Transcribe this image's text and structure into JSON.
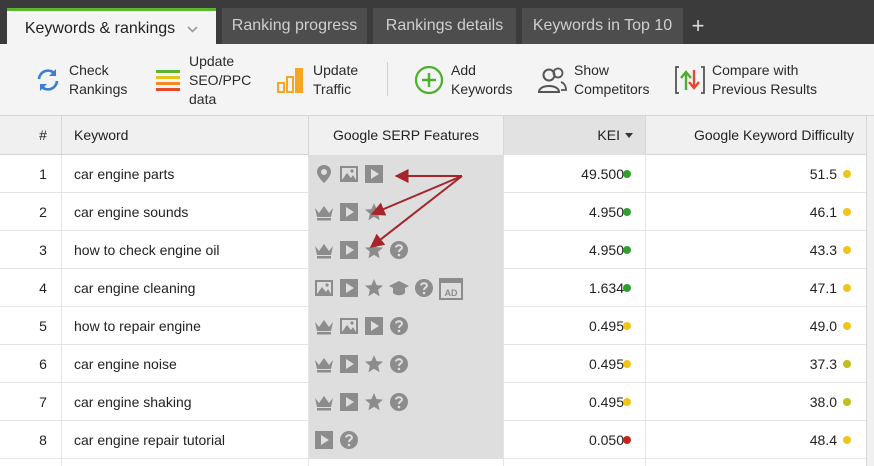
{
  "tabs": [
    {
      "label": "Keywords & rankings",
      "active": true
    },
    {
      "label": "Ranking progress",
      "active": false
    },
    {
      "label": "Rankings details",
      "active": false
    },
    {
      "label": "Keywords in Top 10",
      "active": false
    }
  ],
  "add_tab_label": "+",
  "toolbar": {
    "check_rankings": "Check Rankings",
    "update_seo": "Update SEO/PPC data",
    "update_traffic": "Update Traffic",
    "add_keywords": "Add Keywords",
    "show_competitors": "Show Competitors",
    "compare": "Compare with Previous Results"
  },
  "table": {
    "headers": {
      "num": "#",
      "keyword": "Keyword",
      "serp": "Google SERP Features",
      "kei": "KEI",
      "gkd": "Google Keyword Difficulty"
    },
    "colors": {
      "green": "#2ea02e",
      "yellow": "#f0c419",
      "olive": "#c2bf1a",
      "red": "#c0271e",
      "icon": "#8c8c8c",
      "arrow": "#a5252b"
    },
    "rows": [
      {
        "num": "1",
        "keyword": "car engine parts",
        "serp": [
          "map-pin-icon",
          "image-icon",
          "video-icon"
        ],
        "kei": "49.500",
        "kei_color": "green",
        "gkd": "51.5",
        "gkd_color": "yellow"
      },
      {
        "num": "2",
        "keyword": "car engine sounds",
        "serp": [
          "crown-icon",
          "video-icon",
          "star-icon"
        ],
        "kei": "4.950",
        "kei_color": "green",
        "gkd": "46.1",
        "gkd_color": "yellow"
      },
      {
        "num": "3",
        "keyword": "how to check engine oil",
        "serp": [
          "crown-icon",
          "video-icon",
          "star-icon",
          "question-icon"
        ],
        "kei": "4.950",
        "kei_color": "green",
        "gkd": "43.3",
        "gkd_color": "yellow"
      },
      {
        "num": "4",
        "keyword": "car engine cleaning",
        "serp": [
          "image-icon",
          "video-icon",
          "star-icon",
          "graduation-cap-icon",
          "question-icon",
          "ad-icon"
        ],
        "kei": "1.634",
        "kei_color": "green",
        "gkd": "47.1",
        "gkd_color": "yellow"
      },
      {
        "num": "5",
        "keyword": "how to repair engine",
        "serp": [
          "crown-icon",
          "image-icon",
          "video-icon",
          "question-icon"
        ],
        "kei": "0.495",
        "kei_color": "yellow",
        "gkd": "49.0",
        "gkd_color": "yellow"
      },
      {
        "num": "6",
        "keyword": "car engine noise",
        "serp": [
          "crown-icon",
          "video-icon",
          "star-icon",
          "question-icon"
        ],
        "kei": "0.495",
        "kei_color": "yellow",
        "gkd": "37.3",
        "gkd_color": "olive"
      },
      {
        "num": "7",
        "keyword": "car engine shaking",
        "serp": [
          "crown-icon",
          "video-icon",
          "star-icon",
          "question-icon"
        ],
        "kei": "0.495",
        "kei_color": "yellow",
        "gkd": "38.0",
        "gkd_color": "olive"
      },
      {
        "num": "8",
        "keyword": "car engine repair tutorial",
        "serp": [
          "video-icon",
          "question-icon"
        ],
        "kei": "0.050",
        "kei_color": "red",
        "gkd": "48.4",
        "gkd_color": "yellow"
      }
    ]
  }
}
